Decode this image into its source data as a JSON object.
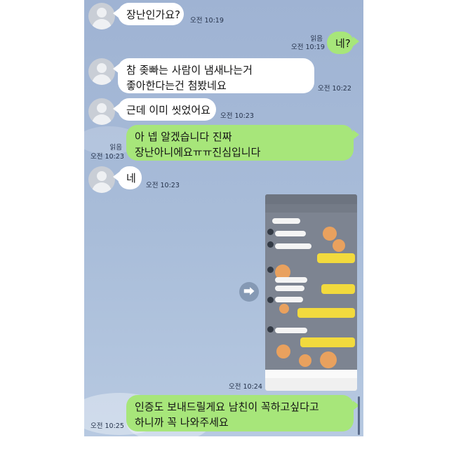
{
  "messages": [
    {
      "text": "장난인가요?",
      "time": "오전 10:19"
    },
    {
      "text": "네?",
      "time": "오전 10:19",
      "read": "읽음"
    },
    {
      "line1": "참 좆빠는 사람이 냄새나는거",
      "line2": "좋아한다는건 첨봤네요",
      "time": "오전 10:22"
    },
    {
      "text": "근데 이미 씻었어요",
      "time": "오전 10:23"
    },
    {
      "line1": "아 넵 알겠습니다 진짜",
      "line2": "장난아니에요ㅠㅠ진심입니다",
      "time": "오전 10:23",
      "read": "읽음"
    },
    {
      "text": "네",
      "time": "오전 10:23"
    },
    {
      "time": "오전 10:24"
    },
    {
      "line1": "인증도 보내드릴게요 남친이 꼭하고싶다고",
      "line2": "하니까 꼭 나와주세요",
      "time": "오전 10:25"
    }
  ],
  "share_icon": "share-icon",
  "colors": {
    "background": "#a9bdd9",
    "sent": "#a7e67a",
    "received": "#ffffff"
  }
}
